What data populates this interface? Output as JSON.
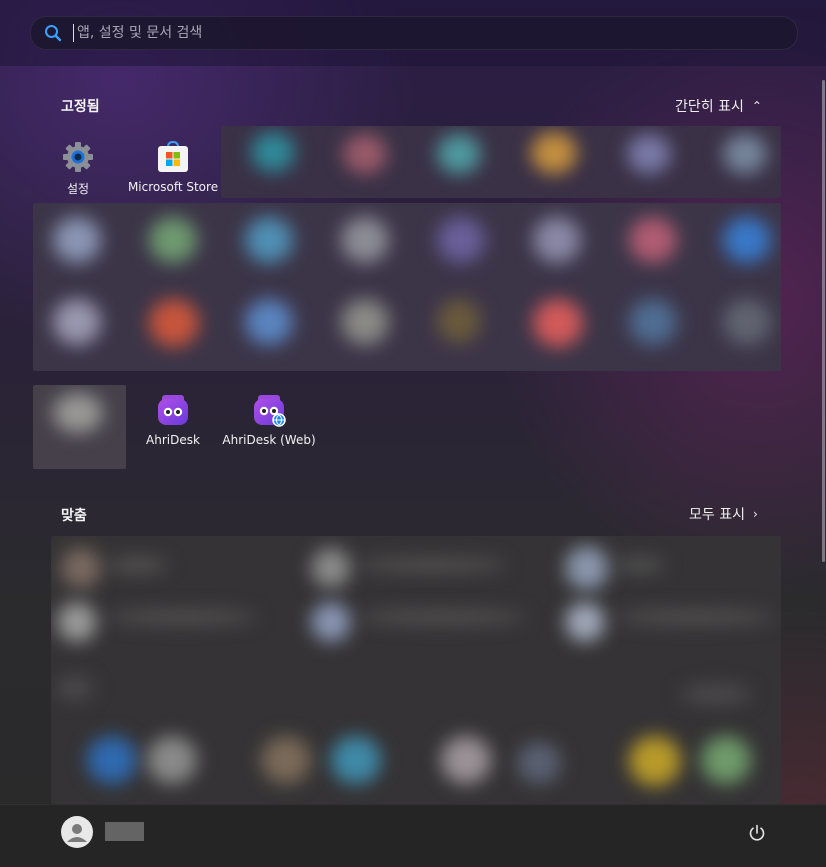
{
  "search": {
    "placeholder": "앱, 설정 및 문서 검색"
  },
  "pinned": {
    "title": "고정됨",
    "toggle_label": "간단히 표시",
    "apps": [
      {
        "label": "설정",
        "icon": "gear-icon"
      },
      {
        "label": "Microsoft Store",
        "icon": "store-icon"
      },
      {
        "label": "AhriDesk",
        "icon": "ahridesk-icon"
      },
      {
        "label": "AhriDesk (Web)",
        "icon": "ahridesk-web-icon"
      }
    ]
  },
  "recommended": {
    "title": "맞춤",
    "more_label": "모두 표시"
  },
  "colors": {
    "accent": "#1e88e5",
    "ahridesk_purple": "#8e3fe0"
  }
}
